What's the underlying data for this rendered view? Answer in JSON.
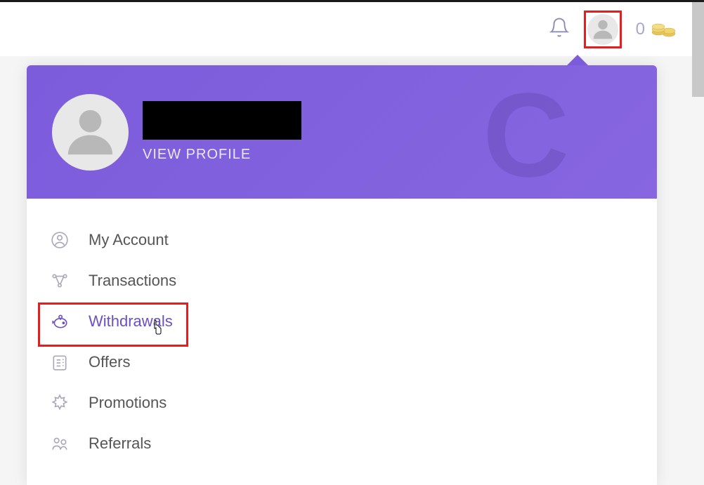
{
  "header": {
    "balance": "0"
  },
  "profile": {
    "viewProfileLabel": "VIEW PROFILE",
    "bgLetter": "C"
  },
  "menu": {
    "items": [
      {
        "label": "My Account"
      },
      {
        "label": "Transactions"
      },
      {
        "label": "Withdrawals"
      },
      {
        "label": "Offers"
      },
      {
        "label": "Promotions"
      },
      {
        "label": "Referrals"
      }
    ]
  }
}
